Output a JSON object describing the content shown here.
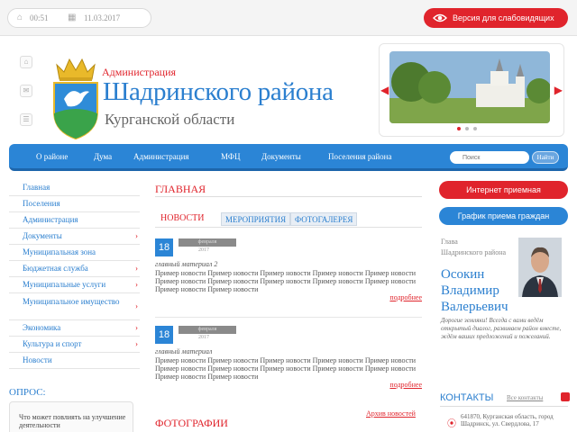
{
  "topbar": {
    "time": "00:51",
    "date": "11.03.2017",
    "accessible_label": "Версия для слабовидящих"
  },
  "header": {
    "admin_label": "Администрация",
    "region_title": "Шадринского района",
    "oblast_title": "Курганской области"
  },
  "nav": {
    "items": [
      "О районе",
      "Дума",
      "Администрация",
      "МФЦ",
      "Документы",
      "Поселения района"
    ],
    "search_placeholder": "Поиск",
    "search_button": "Найти"
  },
  "sidebar": {
    "items": [
      "Главная",
      "Поселения",
      "Администрация",
      "Документы",
      "Муниципальная зона",
      "Бюджетная служба",
      "Муниципальные услуги",
      "Муниципальное имущество",
      "Экономика",
      "Культура и спорт",
      "Новости"
    ]
  },
  "poll": {
    "title": "ОПРОС:",
    "question": "Что может повлиять на улучшение деятельности"
  },
  "main": {
    "title": "ГЛАВНАЯ",
    "tabs": [
      "НОВОСТИ",
      "МЕРОПРИЯТИЯ",
      "ФОТОГАЛЕРЕЯ"
    ],
    "news": [
      {
        "day": "18",
        "month": "февраля",
        "year": "2017",
        "title": "главный материал 2",
        "text": "Пример новости Пример новости Пример новости Пример новости Пример новости Пример новости Пример новости Пример новости Пример новости Пример новости Пример новости Пример новости",
        "more": "подробнее"
      },
      {
        "day": "18",
        "month": "февраля",
        "year": "2017",
        "title": "главный материал",
        "text": "Пример новости Пример новости Пример новости Пример новости Пример новости Пример новости Пример новости Пример новости Пример новости Пример новости Пример новости Пример новости",
        "more": "подробнее"
      }
    ],
    "archive_link": "Архив новостей",
    "photos_title": "ФОТОГРАФИИ"
  },
  "right": {
    "reception_button": "Интернет приемная",
    "schedule_button": "График приема граждан",
    "head_role_1": "Глава",
    "head_role_2": "Шадринского района",
    "head_name": "Осокин Владимир Валерьевич",
    "head_text": "Дорогие земляки! Всегда с вами ведём открытый диалог, развиваем район вместе, ждём ваших предложений и пожеланий.",
    "contacts_title": "КОНТАКТЫ",
    "contacts_link": "Все контакты",
    "contacts_address": "641870, Курганская область, город Шадринск, ул. Свердлова, 17"
  }
}
